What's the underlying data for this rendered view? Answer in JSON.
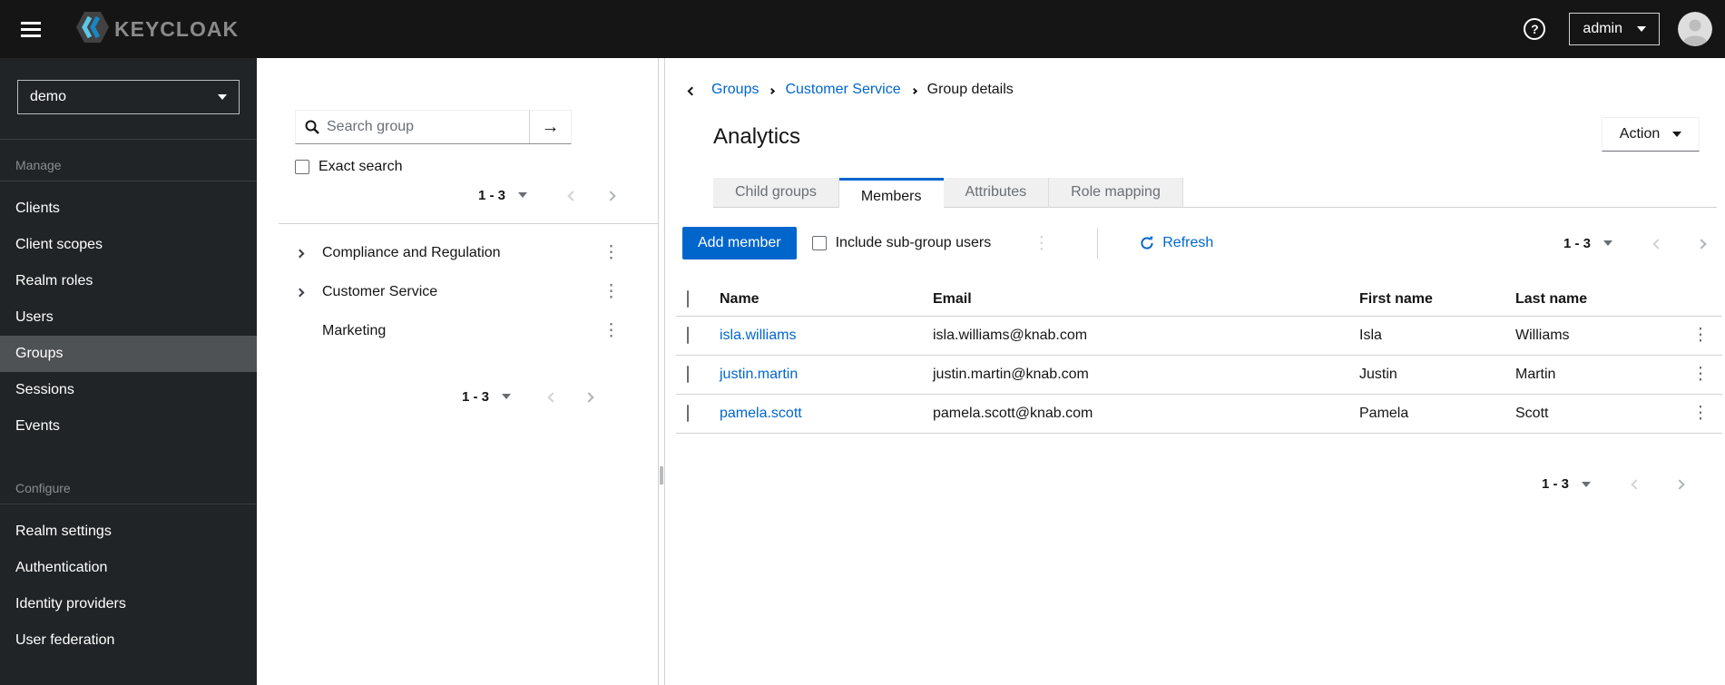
{
  "colors": {
    "accent": "#0066cc",
    "masthead_bg": "#151515",
    "sidebar_bg": "#212427",
    "sidebar_selected_bg": "#4f5255",
    "tab_inactive_bg": "#f0f0f0",
    "border": "#d2d2d2",
    "text": "#151515",
    "muted": "#6a6e73"
  },
  "icons": {
    "arrow_right": "→",
    "kebab": "⋮",
    "help": "?"
  },
  "masthead": {
    "brand": "KEYCLOAK",
    "username": "admin"
  },
  "sidebar": {
    "realm_selector": {
      "value": "demo"
    },
    "sections": [
      {
        "label": "Manage",
        "items": [
          {
            "label": "Clients"
          },
          {
            "label": "Client scopes"
          },
          {
            "label": "Realm roles"
          },
          {
            "label": "Users"
          },
          {
            "label": "Groups",
            "selected": true
          },
          {
            "label": "Sessions"
          },
          {
            "label": "Events"
          }
        ]
      },
      {
        "label": "Configure",
        "items": [
          {
            "label": "Realm settings"
          },
          {
            "label": "Authentication"
          },
          {
            "label": "Identity providers"
          },
          {
            "label": "User federation"
          }
        ]
      }
    ]
  },
  "group_tree_panel": {
    "search": {
      "placeholder": "Search group"
    },
    "exact_search_label": "Exact search",
    "pagination": {
      "range": "1 - 3"
    },
    "groups": [
      {
        "label": "Compliance and Regulation",
        "expandable": true
      },
      {
        "label": "Customer Service",
        "expandable": true
      },
      {
        "label": "Marketing",
        "expandable": false
      }
    ]
  },
  "main": {
    "breadcrumb": {
      "items": [
        "Groups",
        "Customer Service",
        "Group details"
      ]
    },
    "page_title": "Analytics",
    "action_menu_label": "Action",
    "tabs": {
      "items": [
        "Child groups",
        "Members",
        "Attributes",
        "Role mapping"
      ],
      "active": "Members"
    },
    "toolbar": {
      "add_member_label": "Add member",
      "include_subgroup_label": "Include sub-group users",
      "refresh_label": "Refresh",
      "pagination": {
        "range": "1 - 3"
      }
    },
    "members_table": {
      "columns": [
        "Name",
        "Email",
        "First name",
        "Last name"
      ],
      "rows": [
        {
          "name": "isla.williams",
          "email": "isla.williams@knab.com",
          "first_name": "Isla",
          "last_name": "Williams"
        },
        {
          "name": "justin.martin",
          "email": "justin.martin@knab.com",
          "first_name": "Justin",
          "last_name": "Martin"
        },
        {
          "name": "pamela.scott",
          "email": "pamela.scott@knab.com",
          "first_name": "Pamela",
          "last_name": "Scott"
        }
      ]
    },
    "bottom_pagination": {
      "range": "1 - 3"
    }
  }
}
